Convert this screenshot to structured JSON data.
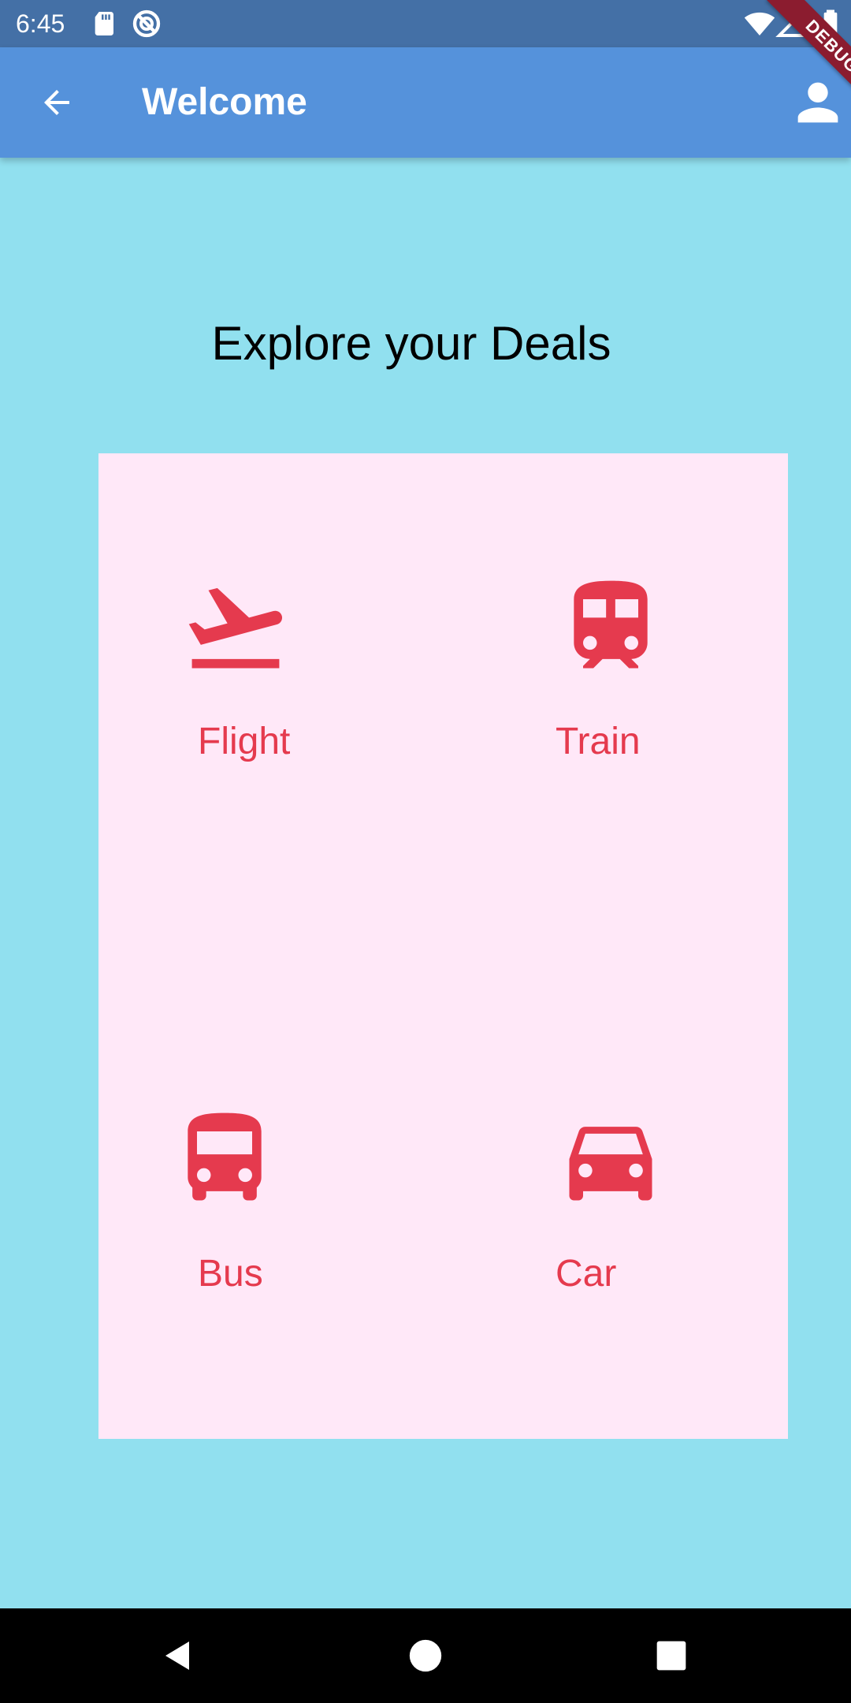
{
  "status_bar": {
    "time": "6:45",
    "icons": [
      "sd-card-icon",
      "sync-icon",
      "wifi-icon",
      "signal-icon",
      "battery-icon"
    ]
  },
  "app_bar": {
    "title": "Welcome",
    "back_icon": "arrow-back-icon",
    "action_icon": "person-icon",
    "background": "#5592db"
  },
  "debug_banner": {
    "label": "DEBUG"
  },
  "main": {
    "heading": "Explore your Deals",
    "background": "#91e0ef",
    "card_background": "#ffe8f8",
    "accent": "#e53a4e",
    "deals": [
      {
        "label": "Flight",
        "icon": "flight-takeoff-icon"
      },
      {
        "label": "Train",
        "icon": "train-icon"
      },
      {
        "label": "Bus",
        "icon": "bus-icon"
      },
      {
        "label": "Car",
        "icon": "car-icon"
      }
    ]
  },
  "nav_bar": {
    "buttons": [
      "back-triangle-icon",
      "home-circle-icon",
      "recents-square-icon"
    ]
  }
}
